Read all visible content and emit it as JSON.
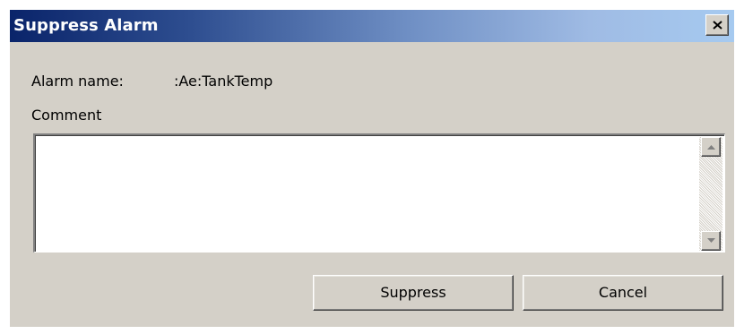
{
  "window": {
    "title": "Suppress Alarm",
    "close_icon": "close-x-icon"
  },
  "form": {
    "alarm_name_label": "Alarm name:",
    "alarm_name_value": ":Ae:TankTemp",
    "comment_label": "Comment",
    "comment_value": ""
  },
  "scrollbar": {
    "up_icon": "arrow-up-icon",
    "down_icon": "arrow-down-icon"
  },
  "buttons": {
    "suppress_label": "Suppress",
    "cancel_label": "Cancel"
  }
}
